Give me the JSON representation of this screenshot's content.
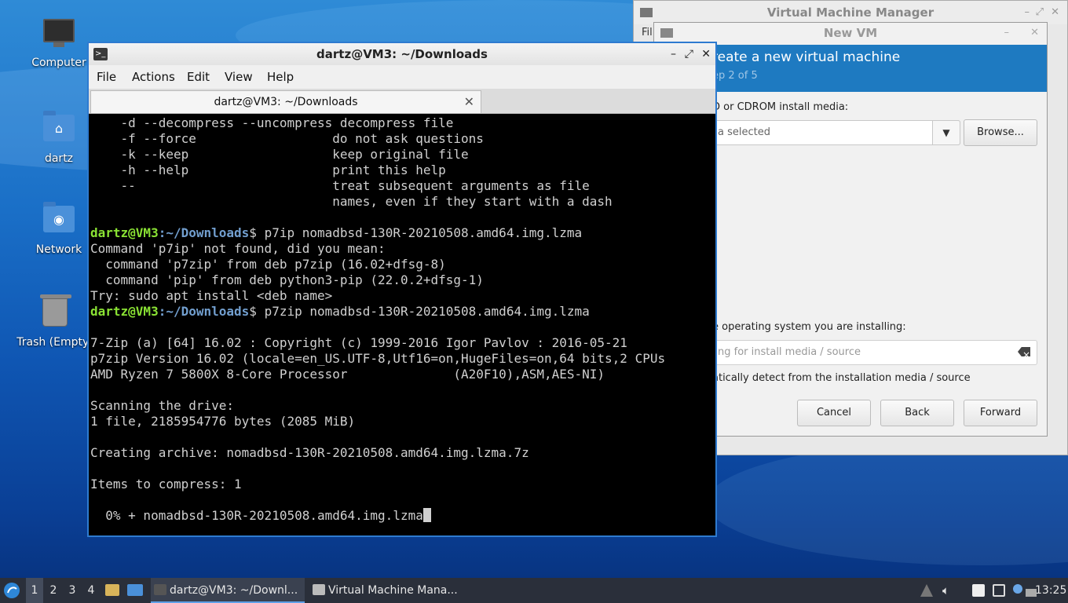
{
  "desktop": {
    "icons": [
      {
        "label": "Computer"
      },
      {
        "label": "dartz"
      },
      {
        "label": "Network"
      },
      {
        "label": "Trash (Empty)"
      }
    ]
  },
  "vmm": {
    "title": "Virtual Machine Manager",
    "menu_file": "Fil"
  },
  "newvm": {
    "title": "New VM",
    "heading": "reate a new virtual machine",
    "step": "ep 2 of 5",
    "media_label": "D or CDROM install media:",
    "media_value": "a selected",
    "browse_label": "Browse...",
    "os_label": "e operating system you are installing:",
    "os_placeholder": "ng for install media / source",
    "auto_detect": "atically detect from the installation media / source",
    "cancel_label": "Cancel",
    "back_label": "Back",
    "forward_label": "Forward"
  },
  "terminal": {
    "title": "dartz@VM3: ~/Downloads",
    "menu": [
      "File",
      "Actions",
      "Edit",
      "View",
      "Help"
    ],
    "tab_label": "dartz@VM3: ~/Downloads",
    "prompt_user": "dartz@VM3",
    "prompt_path": ":~/Downloads",
    "lines": [
      "    -d --decompress --uncompress decompress file",
      "    -f --force                  do not ask questions",
      "    -k --keep                   keep original file",
      "    -h --help                   print this help",
      "    --                          treat subsequent arguments as file",
      "                                names, even if they start with a dash",
      "",
      "$ p7ip nomadbsd-130R-20210508.amd64.img.lzma",
      "Command 'p7ip' not found, did you mean:",
      "  command 'p7zip' from deb p7zip (16.02+dfsg-8)",
      "  command 'pip' from deb python3-pip (22.0.2+dfsg-1)",
      "Try: sudo apt install <deb name>",
      "$ p7zip nomadbsd-130R-20210508.amd64.img.lzma",
      "",
      "7-Zip (a) [64] 16.02 : Copyright (c) 1999-2016 Igor Pavlov : 2016-05-21",
      "p7zip Version 16.02 (locale=en_US.UTF-8,Utf16=on,HugeFiles=on,64 bits,2 CPUs",
      "AMD Ryzen 7 5800X 8-Core Processor              (A20F10),ASM,AES-NI)",
      "",
      "Scanning the drive:",
      "1 file, 2185954776 bytes (2085 MiB)",
      "",
      "Creating archive: nomadbsd-130R-20210508.amd64.img.lzma.7z",
      "",
      "Items to compress: 1",
      "",
      "  0% + nomadbsd-130R-20210508.amd64.img.lzma"
    ]
  },
  "taskbar": {
    "workspaces": [
      "1",
      "2",
      "3",
      "4"
    ],
    "tasks": [
      {
        "label": "dartz@VM3: ~/Downl..."
      },
      {
        "label": "Virtual Machine Mana..."
      }
    ],
    "clock": "13:25"
  }
}
